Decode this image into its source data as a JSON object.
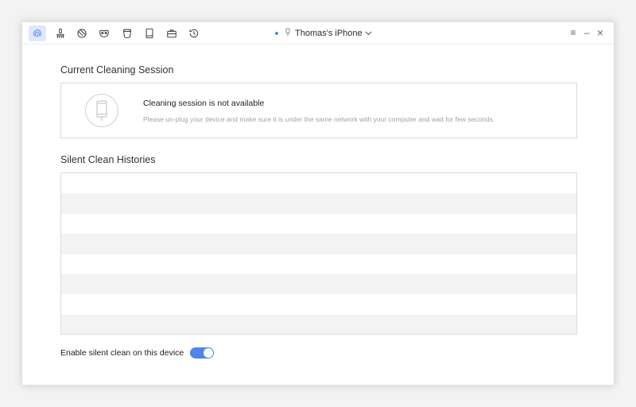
{
  "toolbar": {
    "icons": [
      "fingerprint-icon",
      "broom-icon",
      "browser-icon",
      "mask-icon",
      "bucket-icon",
      "tablet-icon",
      "toolbox-icon",
      "history-icon"
    ],
    "active_index": 0
  },
  "device": {
    "name": "Thomas's iPhone",
    "status_color": "#4f86e9"
  },
  "window_controls": {
    "menu": "≡",
    "minimize": "–",
    "close": "×"
  },
  "current_session": {
    "title": "Current Cleaning Session",
    "heading": "Cleaning session is not available",
    "description": "Please un-plug your device and make sure it is under the same network with your computer and wait for few seconds."
  },
  "histories": {
    "title": "Silent Clean Histories",
    "rows": 8
  },
  "silent_clean": {
    "label": "Enable silent clean on this device",
    "enabled": true
  },
  "colors": {
    "accent": "#4f86e9",
    "active_tab_bg": "#dfe8fb",
    "row_stripe": "#f3f3f3"
  }
}
